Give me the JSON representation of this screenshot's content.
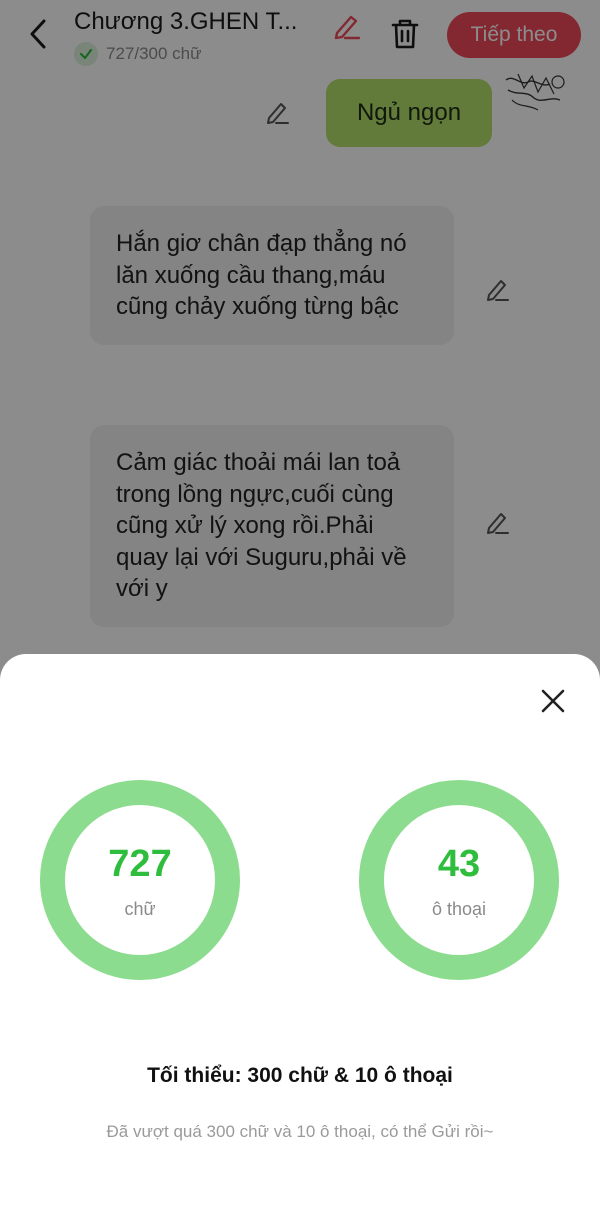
{
  "header": {
    "title": "Chương 3.GHEN T...",
    "word_count": "727/300 chữ",
    "next_label": "Tiếp theo"
  },
  "chat": {
    "right_message": "Ngủ ngọn",
    "left_messages": [
      "Hắn giơ chân đạp thẳng nó lăn xuống cầu thang,máu cũng chảy xuống từng bậc",
      "Cảm giác thoải mái lan toả trong lồng ngực,cuối cùng cũng xử lý xong rồi.Phải quay lại với Suguru,phải về với y"
    ]
  },
  "sheet": {
    "words": {
      "value": "727",
      "label": "chữ"
    },
    "dialogues": {
      "value": "43",
      "label": "ô thoại"
    },
    "minimum": "Tối thiểu: 300 chữ & 10 ô thoại",
    "hint": "Đã vượt quá 300 chữ và 10 ô thoại, có thể Gửi rồi~"
  },
  "colors": {
    "accent_red": "#ef4a5a",
    "bubble_green": "#b4e06a",
    "ring_green": "#8bdc8e",
    "value_green": "#2ebd3c"
  },
  "icons": [
    "back-arrow-icon",
    "check-icon",
    "pencil-icon",
    "trash-icon",
    "close-icon"
  ]
}
